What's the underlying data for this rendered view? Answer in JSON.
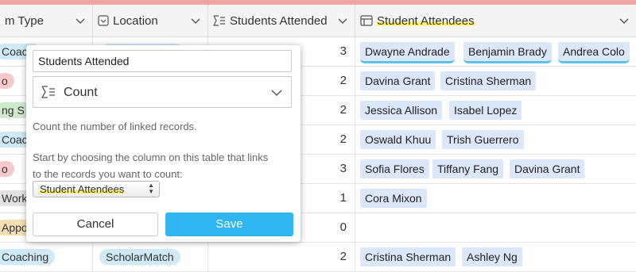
{
  "columns": [
    {
      "label": "m Type",
      "icon": "single-select-icon"
    },
    {
      "label": "Location",
      "icon": "single-select-icon"
    },
    {
      "label": "Students Attended",
      "icon": "sigma-list-icon"
    },
    {
      "label": "Student Attendees",
      "icon": "linked-record-icon"
    }
  ],
  "rows": [
    {
      "type": "Coach",
      "location": "",
      "count": "3",
      "attendees": [
        "Dwayne Andrade",
        "Benjamin Brady",
        "Andrea Colo"
      ]
    },
    {
      "type": "o",
      "location": "",
      "count": "2",
      "attendees": [
        "Davina Grant",
        "Cristina Sherman"
      ]
    },
    {
      "type": "ng S",
      "location": "",
      "count": "2",
      "attendees": [
        "Jessica Allison",
        "Isabel Lopez"
      ]
    },
    {
      "type": "Coac",
      "location": "",
      "count": "2",
      "attendees": [
        "Oswald Khuu",
        "Trish Guerrero"
      ]
    },
    {
      "type": "o",
      "location": "",
      "count": "3",
      "attendees": [
        "Sofia Flores",
        "Tiffany Fang",
        "Davina Grant"
      ]
    },
    {
      "type": "Works",
      "location": "",
      "count": "1",
      "attendees": [
        "Cora Mixon"
      ]
    },
    {
      "type": "Appo",
      "location": "",
      "count": "0",
      "attendees": []
    },
    {
      "type": "Coaching",
      "location": "ScholarMatch",
      "count": "2",
      "attendees": [
        "Cristina Sherman",
        "Ashley Ng"
      ]
    }
  ],
  "colors": {
    "pill_blue": "#cfe9f7",
    "pill_red": "#f7c9cb",
    "pill_green": "#cdeacb",
    "pill_orange": "#f6dfb3",
    "pill_gray": "#e2e2e2",
    "tag_blue": "#dbe8fb",
    "save_button": "#2fb5f0"
  },
  "popup": {
    "field_name": "Students Attended",
    "field_type": "Count",
    "description": "Count the number of linked records.",
    "hint_line1": "Start by choosing the column on this table that links",
    "hint_line2": "to the records you want to count:",
    "link_field": "Student Attendees",
    "cancel_label": "Cancel",
    "save_label": "Save"
  }
}
